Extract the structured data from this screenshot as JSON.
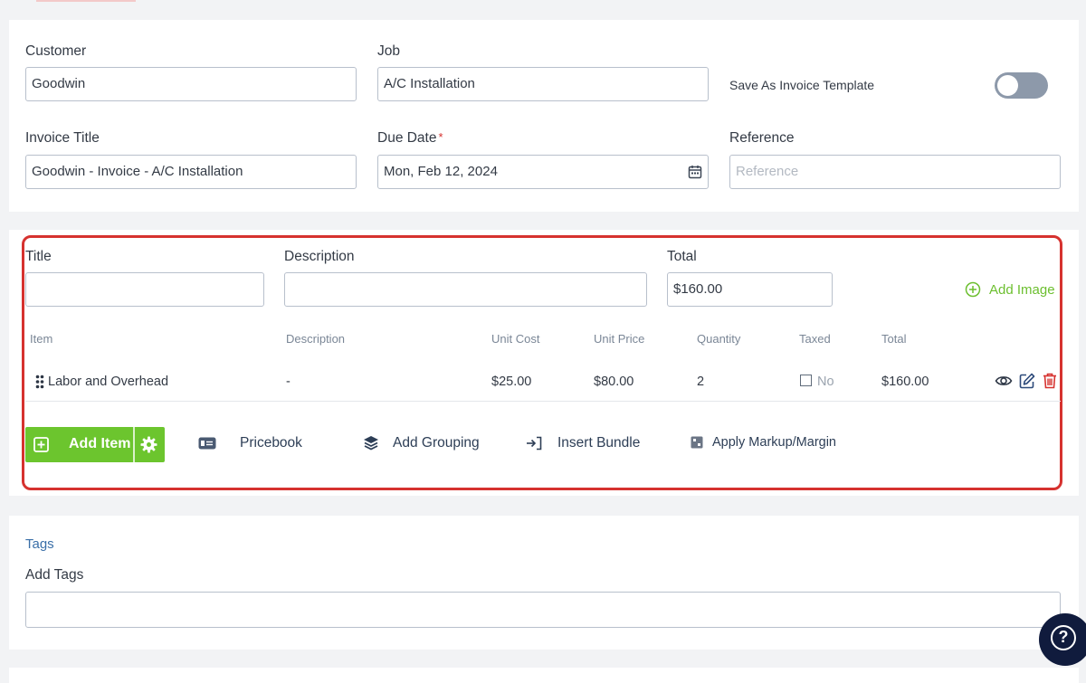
{
  "header": {
    "customer_label": "Customer",
    "customer_value": "Goodwin",
    "job_label": "Job",
    "job_value": "A/C Installation",
    "template_label": "Save As Invoice Template",
    "template_toggle_on": false,
    "invoice_title_label": "Invoice Title",
    "invoice_title_value": "Goodwin - Invoice - A/C Installation",
    "due_date_label": "Due Date",
    "due_date_required": "*",
    "due_date_value": "Mon, Feb 12, 2024",
    "reference_label": "Reference",
    "reference_placeholder": "Reference"
  },
  "group": {
    "title_label": "Title",
    "title_value": "",
    "description_label": "Description",
    "description_value": "",
    "total_label": "Total",
    "total_value": "$160.00",
    "add_image_label": "Add Image"
  },
  "items_table": {
    "columns": [
      "Item",
      "Description",
      "Unit Cost",
      "Unit Price",
      "Quantity",
      "Taxed",
      "Total"
    ],
    "rows": [
      {
        "item": "Labor and Overhead",
        "description": "-",
        "unit_cost": "$25.00",
        "unit_price": "$80.00",
        "quantity": "2",
        "taxed": "No",
        "total": "$160.00"
      }
    ]
  },
  "actions": {
    "add_item": "Add Item",
    "pricebook": "Pricebook",
    "add_grouping": "Add Grouping",
    "insert_bundle": "Insert Bundle",
    "apply_markup": "Apply Markup/Margin"
  },
  "tags": {
    "section_title": "Tags",
    "add_tags_label": "Add Tags",
    "add_tags_value": ""
  },
  "help": {
    "icon": "?"
  },
  "colors": {
    "accent_green": "#6cc52e",
    "highlight_red": "#d6322f",
    "link_blue": "#3a6fa8",
    "toggle_off": "#8d99aa",
    "help_bg": "#101b3d"
  }
}
